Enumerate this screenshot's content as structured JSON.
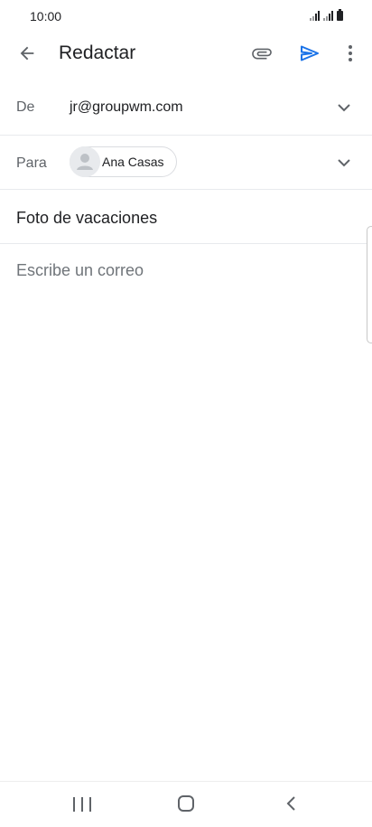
{
  "status_bar": {
    "time": "10:00"
  },
  "app_bar": {
    "title": "Redactar"
  },
  "from_field": {
    "label": "De",
    "value": "jr@groupwm.com"
  },
  "to_field": {
    "label": "Para",
    "recipients": [
      {
        "name": "Ana Casas"
      }
    ]
  },
  "subject": {
    "value": "Foto de vacaciones"
  },
  "body": {
    "placeholder": "Escribe un correo"
  },
  "icons": {
    "back": "arrow-back-icon",
    "attach": "paperclip-icon",
    "send": "send-icon",
    "more": "more-vertical-icon",
    "expand": "chevron-down-icon",
    "avatar": "person-icon"
  },
  "colors": {
    "accent": "#1a73e8",
    "text_primary": "#202124",
    "text_secondary": "#5f6368",
    "divider": "#e8eaed"
  }
}
